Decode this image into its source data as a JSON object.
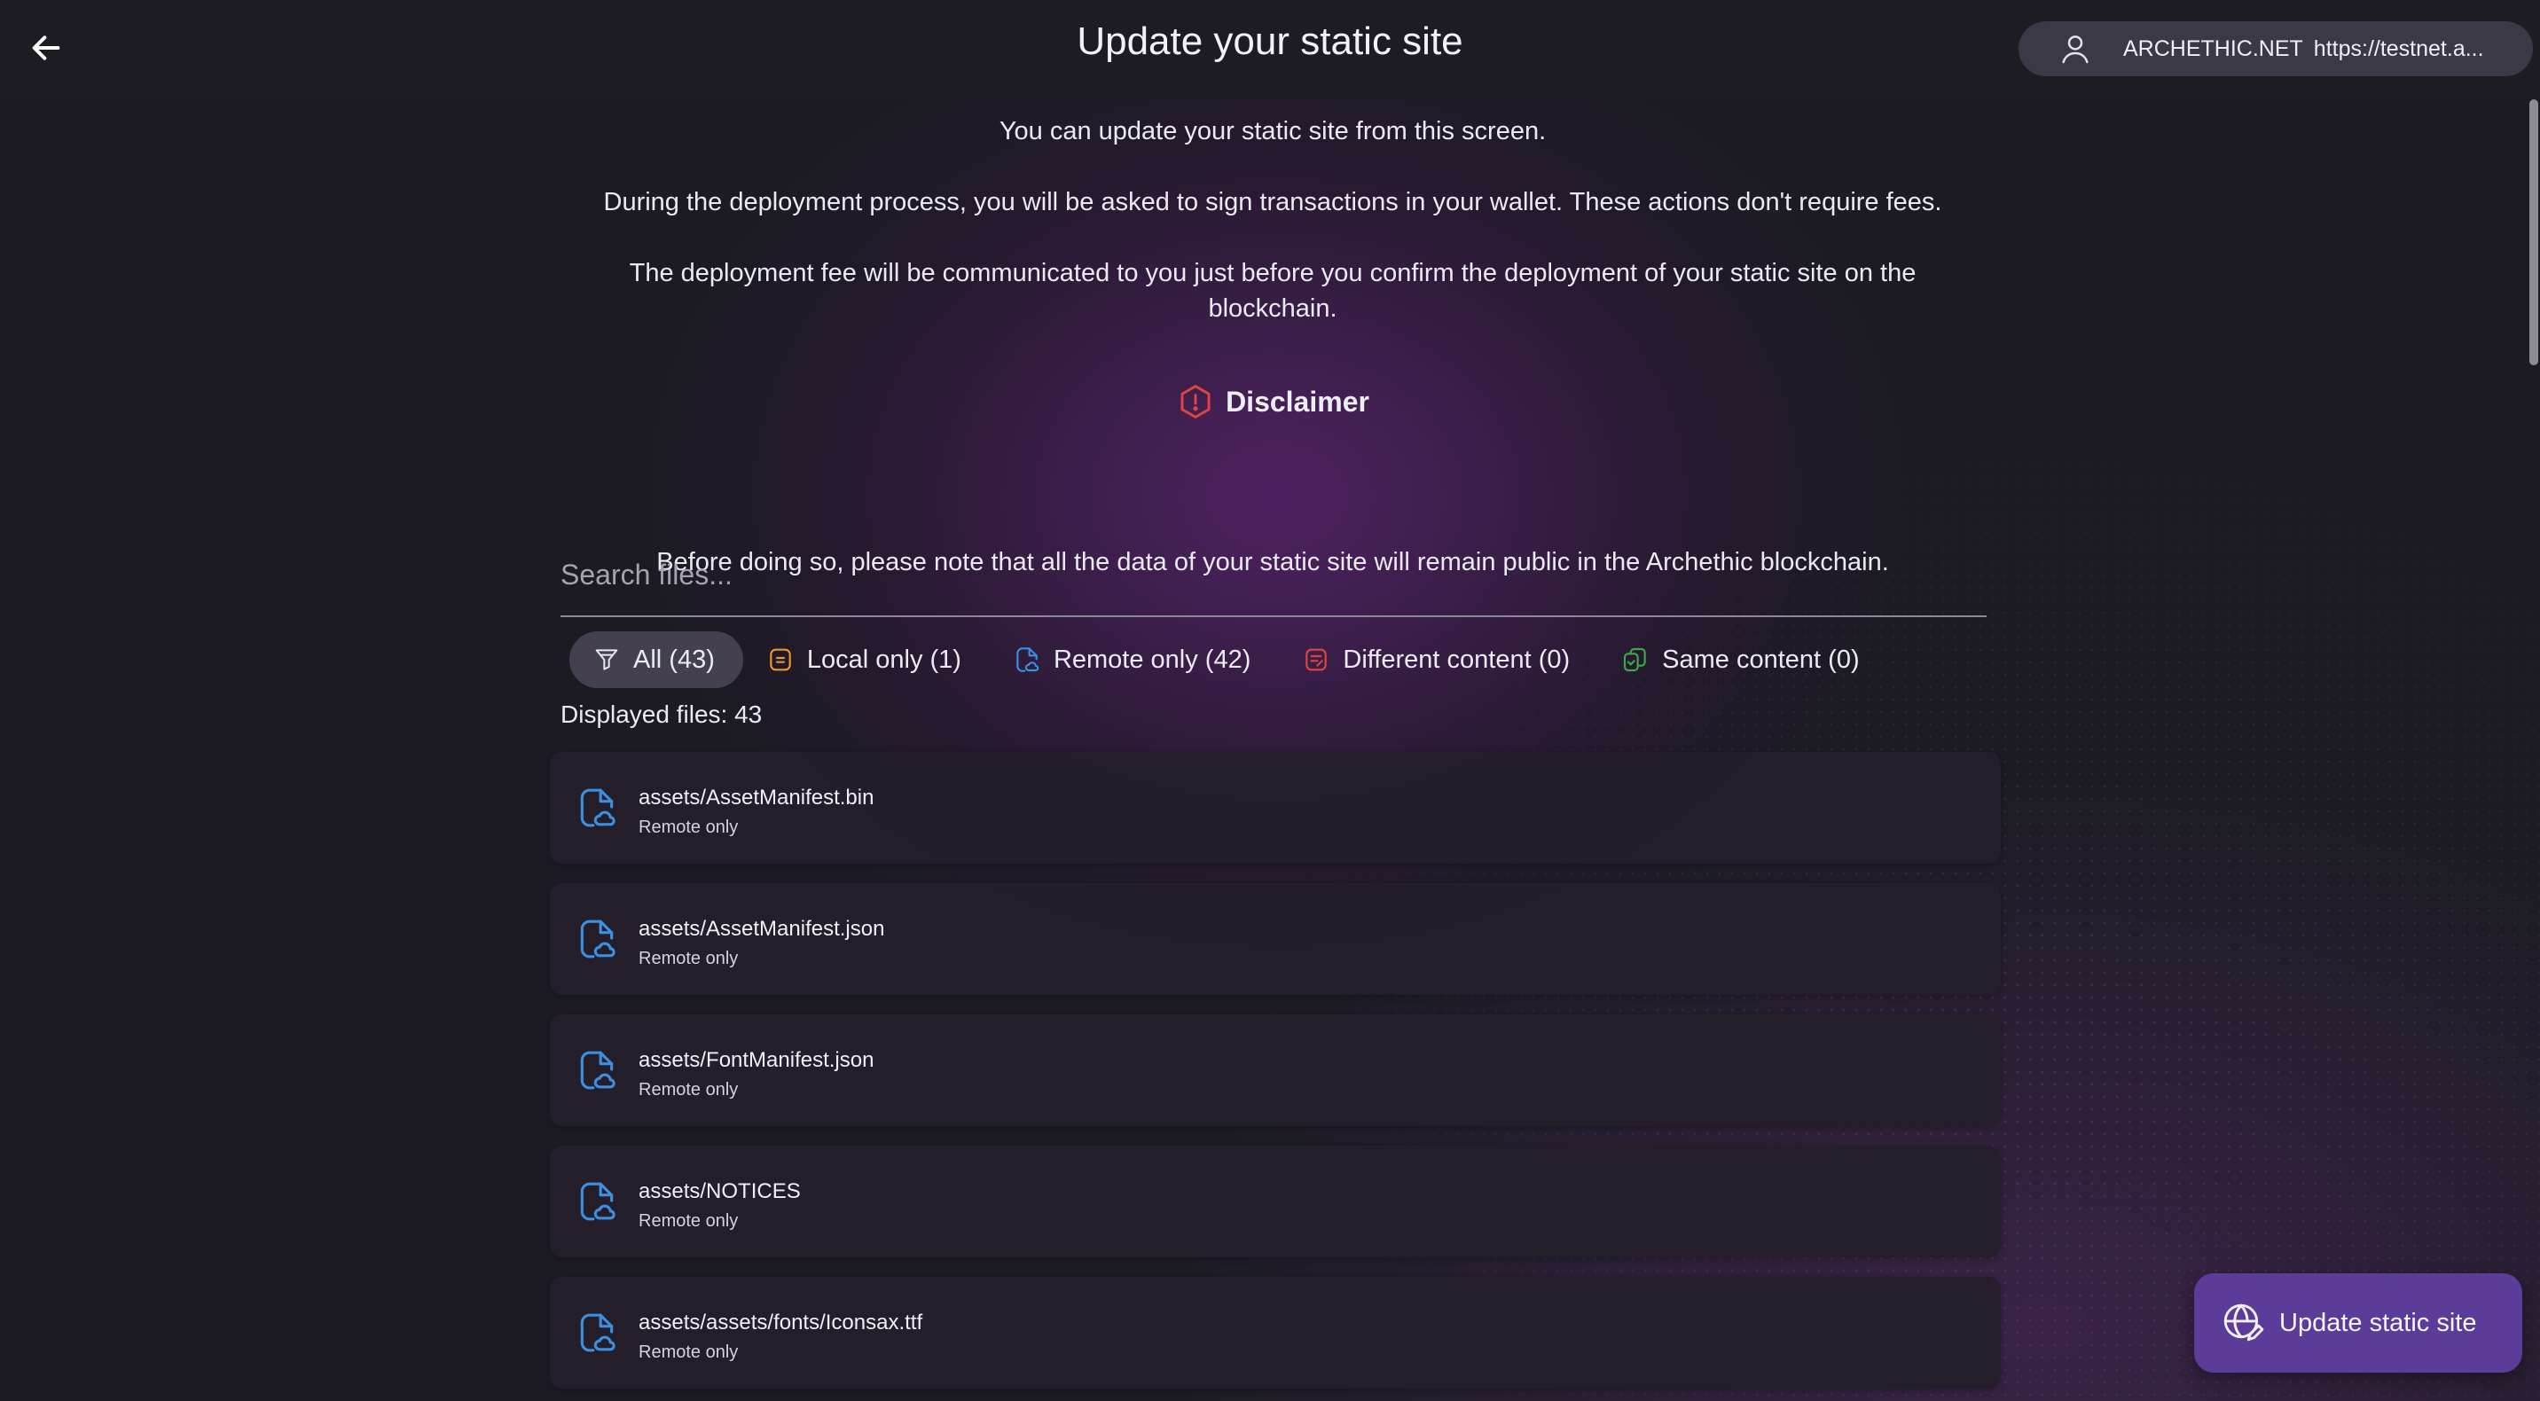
{
  "header": {
    "title": "Update your static site",
    "back_icon": "arrow-left-icon",
    "account": {
      "icon": "user-icon",
      "network": "ARCHETHIC.NET",
      "endpoint": "https://testnet.a..."
    }
  },
  "intro": {
    "line1": "You can update your static site from this screen.",
    "line2": "During the deployment process, you will be asked to sign transactions in your wallet. These actions don't require fees.",
    "line3": "The deployment fee will be communicated to you just before you confirm the deployment of your static site on the blockchain."
  },
  "disclaimer": {
    "icon": "warning-hexagon-icon",
    "title": "Disclaimer",
    "text": "Before doing so, please note that all the data of your static site will remain public in the Archethic blockchain."
  },
  "search": {
    "placeholder": "Search files...",
    "value": ""
  },
  "filters": [
    {
      "label": "All (43)",
      "icon": "filter-icon",
      "active": true
    },
    {
      "label": "Local only (1)",
      "icon": "local-file-icon",
      "active": false
    },
    {
      "label": "Remote only (42)",
      "icon": "remote-file-icon",
      "active": false
    },
    {
      "label": "Different content (0)",
      "icon": "different-file-icon",
      "active": false
    },
    {
      "label": "Same content (0)",
      "icon": "same-file-icon",
      "active": false
    }
  ],
  "displayed_files": "Displayed files: 43",
  "files": [
    {
      "name": "assets/AssetManifest.bin",
      "status": "Remote only"
    },
    {
      "name": "assets/AssetManifest.json",
      "status": "Remote only"
    },
    {
      "name": "assets/FontManifest.json",
      "status": "Remote only"
    },
    {
      "name": "assets/NOTICES",
      "status": "Remote only"
    },
    {
      "name": "assets/assets/fonts/Iconsax.ttf",
      "status": "Remote only"
    }
  ],
  "update_button": {
    "label": "Update static site",
    "icon": "globe-edit-icon"
  },
  "colors": {
    "accent_button": "#5b3c99",
    "remote_icon": "#3d8fe0",
    "local_icon": "#e89a2b",
    "different_icon": "#e0453f",
    "same_icon": "#3fa64a",
    "warning": "#e0453f"
  }
}
